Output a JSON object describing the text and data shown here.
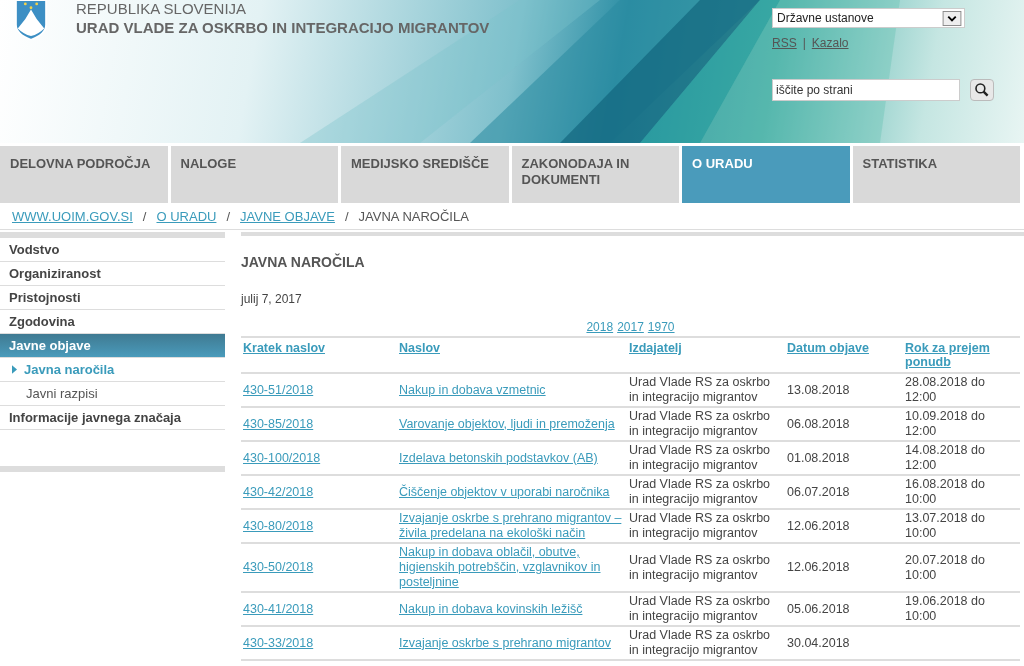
{
  "header": {
    "country": "REPUBLIKA SLOVENIJA",
    "office": "URAD VLADE ZA OSKRBO IN INTEGRACIJO MIGRANTOV",
    "dropdown": {
      "value": "Državne ustanove"
    },
    "links": [
      "RSS",
      "Kazalo"
    ],
    "link_separator": "|",
    "search": {
      "placeholder": "iščite po strani"
    }
  },
  "nav": [
    {
      "label": "DELOVNA PODROČJA",
      "selected": false
    },
    {
      "label": "NALOGE",
      "selected": false
    },
    {
      "label": "MEDIJSKO SREDIŠČE",
      "selected": false
    },
    {
      "label": "ZAKONODAJA IN DOKUMENTI",
      "selected": false
    },
    {
      "label": "O URADU",
      "selected": true
    },
    {
      "label": "STATISTIKA",
      "selected": false
    }
  ],
  "breadcrumb": {
    "links": [
      "WWW.UOIM.GOV.SI",
      "O URADU",
      "JAVNE OBJAVE"
    ],
    "current": "JAVNA NAROČILA",
    "separator": "/"
  },
  "sidebar": [
    {
      "label": "Vodstvo",
      "selected": false
    },
    {
      "label": "Organiziranost",
      "selected": false
    },
    {
      "label": "Pristojnosti",
      "selected": false
    },
    {
      "label": "Zgodovina",
      "selected": false
    },
    {
      "label": "Javne objave",
      "selected": true,
      "children": [
        {
          "label": "Javna naročila",
          "selected": true
        },
        {
          "label": "Javni razpisi",
          "selected": false
        }
      ]
    },
    {
      "label": "Informacije javnega značaja",
      "selected": false
    }
  ],
  "content": {
    "title": "JAVNA NAROČILA",
    "date": "julij 7, 2017",
    "years": [
      "2018",
      "2017",
      "1970"
    ],
    "table": {
      "columns": [
        "Kratek naslov",
        "Naslov",
        "Izdajatelj",
        "Datum objave",
        "Rok za prejem ponudb"
      ],
      "rows": [
        {
          "code": "430-51/2018",
          "title": "Nakup in dobava vzmetnic",
          "issuer": "Urad Vlade RS za oskrbo in integracijo migrantov",
          "published": "13.08.2018",
          "deadline": "28.08.2018 do 12:00"
        },
        {
          "code": "430-85/2018",
          "title": "Varovanje objektov, ljudi in premoženja",
          "issuer": "Urad Vlade RS za oskrbo in integracijo migrantov",
          "published": "06.08.2018",
          "deadline": "10.09.2018 do 12:00"
        },
        {
          "code": "430-100/2018",
          "title": "Izdelava betonskih podstavkov (AB)",
          "issuer": "Urad Vlade RS za oskrbo in integracijo migrantov",
          "published": "01.08.2018",
          "deadline": "14.08.2018 do 12:00"
        },
        {
          "code": "430-42/2018",
          "title": "Čiščenje objektov v uporabi naročnika",
          "issuer": "Urad Vlade RS za oskrbo in integracijo migrantov",
          "published": "06.07.2018",
          "deadline": "16.08.2018 do 10:00"
        },
        {
          "code": "430-80/2018",
          "title": "Izvajanje oskrbe s prehrano migrantov – živila predelana na ekološki način",
          "issuer": "Urad Vlade RS za oskrbo in integracijo migrantov",
          "published": "12.06.2018",
          "deadline": "13.07.2018 do 10:00"
        },
        {
          "code": "430-50/2018",
          "title": "Nakup in dobava oblačil, obutve, higienskih potrebščin, vzglavnikov in posteljnine",
          "issuer": "Urad Vlade RS za oskrbo in integracijo migrantov",
          "published": "12.06.2018",
          "deadline": "20.07.2018 do 10:00"
        },
        {
          "code": "430-41/2018",
          "title": "Nakup in dobava kovinskih ležišč",
          "issuer": "Urad Vlade RS za oskrbo in integracijo migrantov",
          "published": "05.06.2018",
          "deadline": "19.06.2018 do 10:00"
        },
        {
          "code": "430-33/2018",
          "title": "Izvajanje oskrbe s prehrano migrantov",
          "issuer": "Urad Vlade RS za oskrbo in integracijo migrantov",
          "published": "30.04.2018"
        }
      ]
    }
  }
}
